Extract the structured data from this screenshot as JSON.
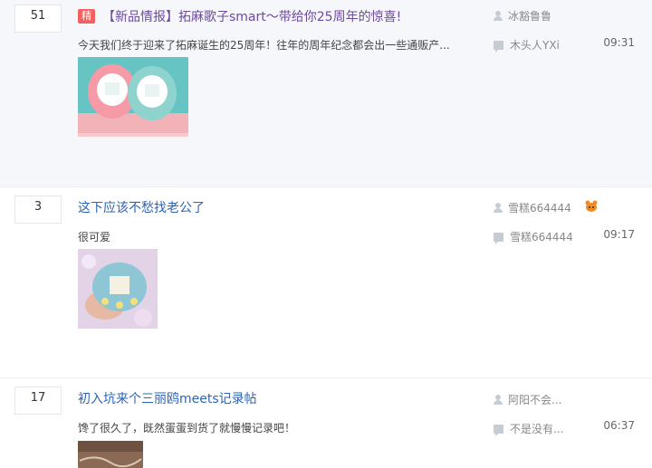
{
  "threads": [
    {
      "reply_count": "51",
      "badge": "精",
      "title": "【新品情报】拓麻歌子smart～带给你25周年的惊喜!",
      "abstract": "今天我们终于迎来了拓麻诞生的25周年！往年的周年纪念都会出一些通贩产...",
      "author": "冰豁鲁鲁",
      "last_replier": "木头人YXi",
      "time": "09:31"
    },
    {
      "reply_count": "3",
      "title": "这下应该不愁找老公了",
      "abstract": "很可爱",
      "author": "雪糕664444",
      "last_replier": "雪糕664444",
      "time": "09:17",
      "author_badge_icon": "orange-crab-badge-icon"
    },
    {
      "reply_count": "17",
      "title": "初入坑来个三丽鸥meets记录帖",
      "abstract": "馋了很久了，既然蛋蛋到货了就慢慢记录吧！",
      "author": "阿阳不会...",
      "last_replier": "不是没有...",
      "time": "06:37"
    }
  ],
  "colors": {
    "link": "#2d64b3",
    "visited_link": "#6e4a9e",
    "badge_red": "#f26060",
    "highlight_bg": "#f5f7fb"
  }
}
